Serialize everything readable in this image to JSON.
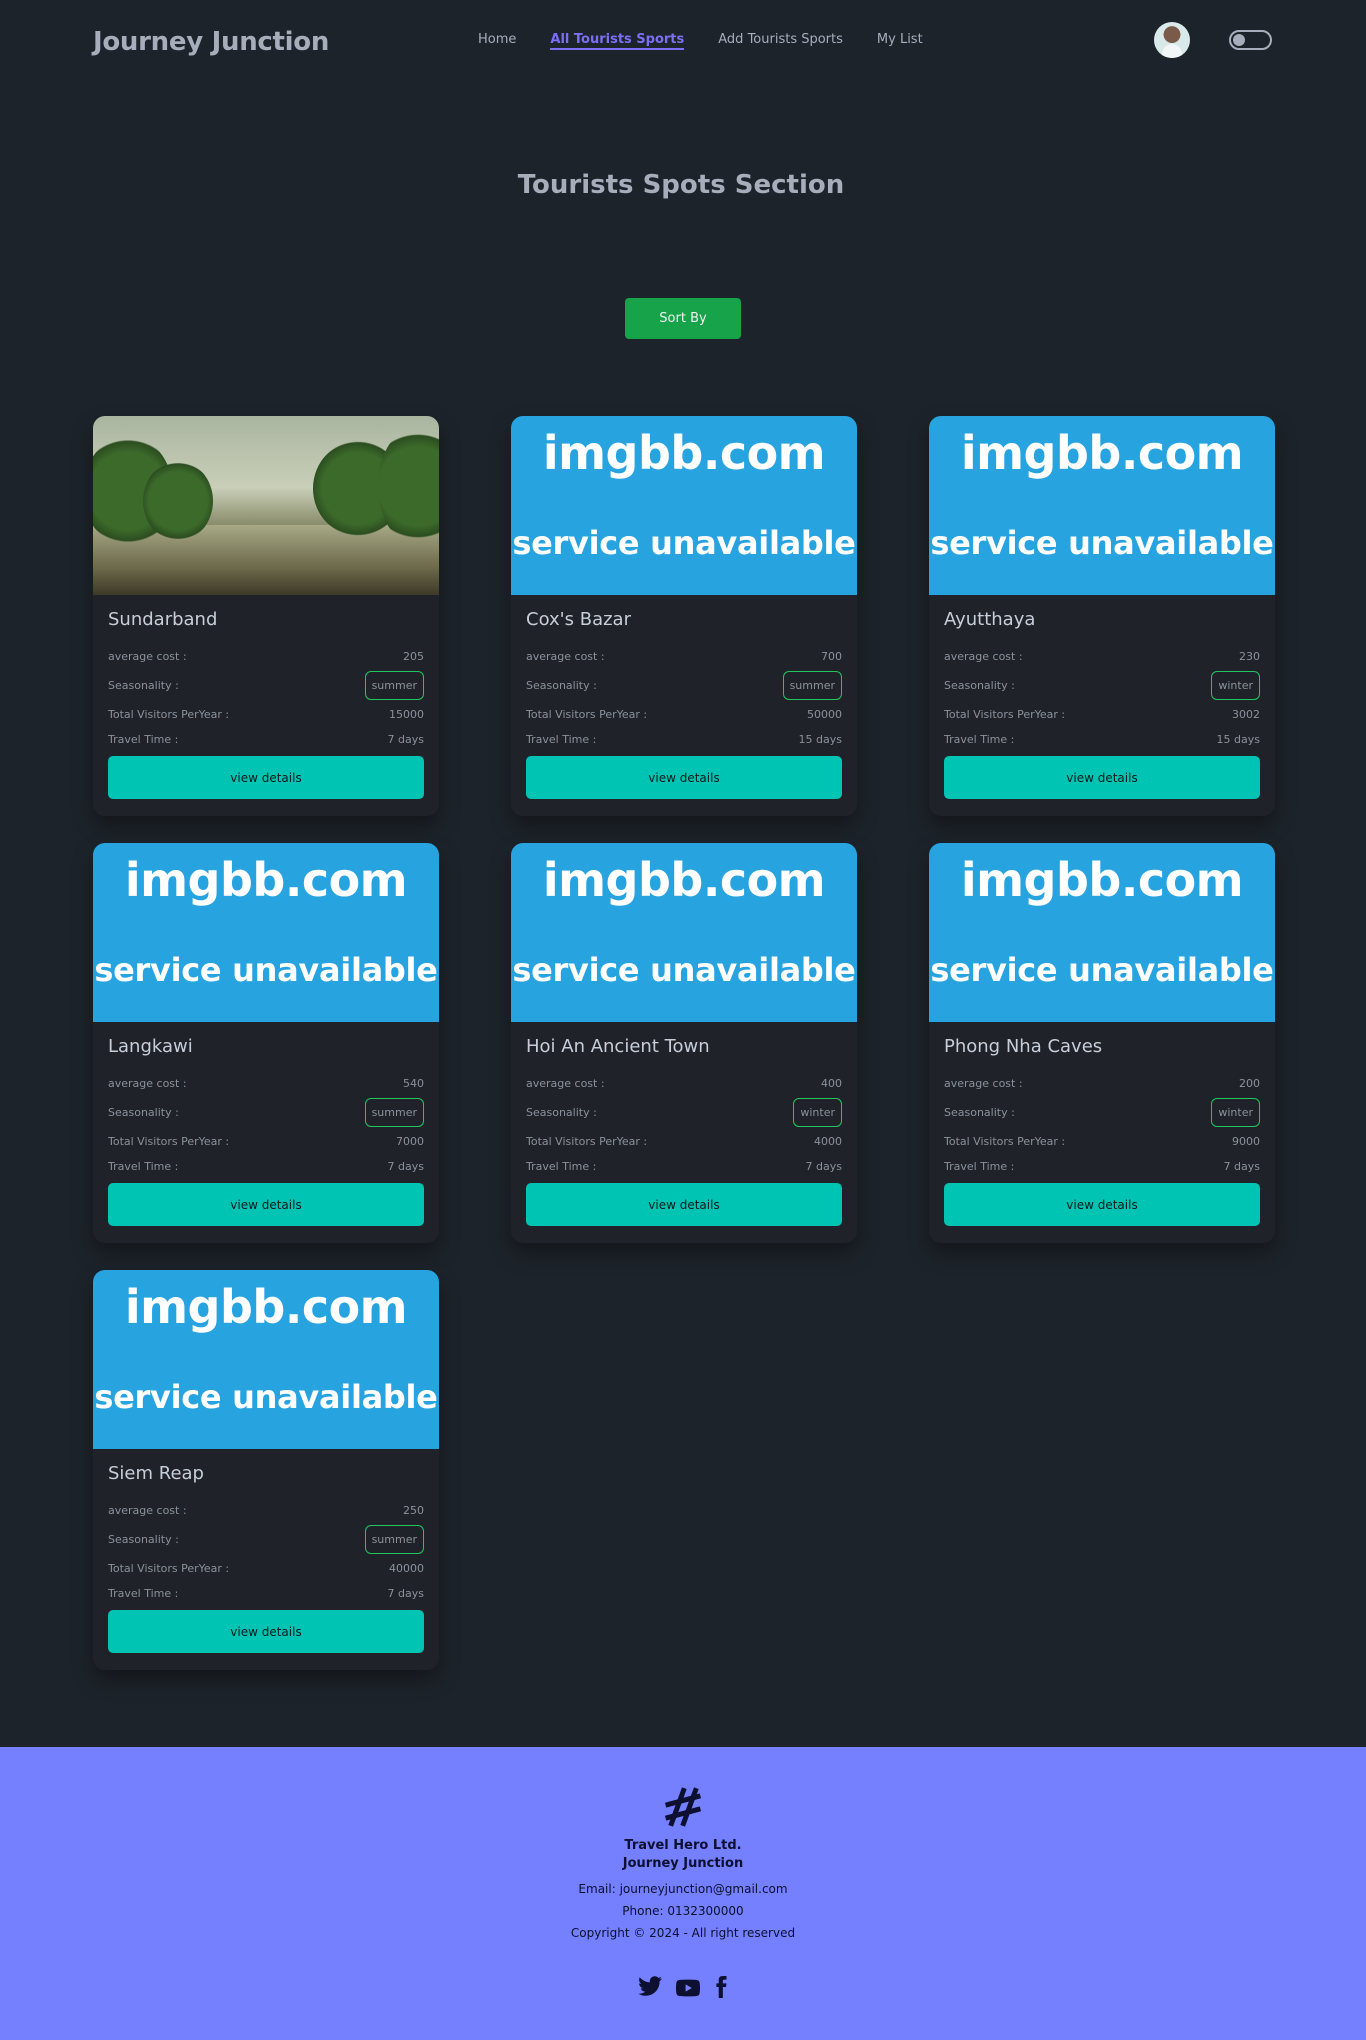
{
  "nav": {
    "brand": "Journey Junction",
    "links": [
      "Home",
      "All Tourists Sports",
      "Add Tourists Sports",
      "My List"
    ],
    "active_index": 1
  },
  "section": {
    "title": "Tourists Spots Section",
    "sort_label": "Sort By"
  },
  "labels": {
    "average_cost": "average cost :",
    "seasonality": "Seasonality :",
    "visitors": "Total Visitors PerYear :",
    "travel_time": "Travel Time :",
    "view_details": "view details",
    "placeholder_line1": "imgbb.com",
    "placeholder_line2": "service unavailable"
  },
  "spots": [
    {
      "name": "Sundarband",
      "cost": "205",
      "season": "summer",
      "visitors": "15000",
      "time": "7 days",
      "image": "photo"
    },
    {
      "name": "Cox's Bazar",
      "cost": "700",
      "season": "summer",
      "visitors": "50000",
      "time": "15 days",
      "image": "placeholder"
    },
    {
      "name": "Ayutthaya",
      "cost": "230",
      "season": "winter",
      "visitors": "3002",
      "time": "15 days",
      "image": "placeholder"
    },
    {
      "name": "Langkawi",
      "cost": "540",
      "season": "summer",
      "visitors": "7000",
      "time": "7 days",
      "image": "placeholder"
    },
    {
      "name": "Hoi An Ancient Town",
      "cost": "400",
      "season": "winter",
      "visitors": "4000",
      "time": "7 days",
      "image": "placeholder"
    },
    {
      "name": "Phong Nha Caves",
      "cost": "200",
      "season": "winter",
      "visitors": "9000",
      "time": "7 days",
      "image": "placeholder"
    },
    {
      "name": "Siem Reap",
      "cost": "250",
      "season": "summer",
      "visitors": "40000",
      "time": "7 days",
      "image": "placeholder"
    }
  ],
  "footer": {
    "company": "Travel Hero Ltd.",
    "brand": "Journey Junction",
    "email": "Email: journeyjunction@gmail.com",
    "phone": "Phone: 0132300000",
    "copyright": "Copyright © 2024 - All right reserved",
    "social_icons": [
      "twitter-icon",
      "youtube-icon",
      "facebook-icon"
    ]
  },
  "colors": {
    "background": "#1d232a",
    "active_link": "#7c6ff6",
    "sort_button": "#16a34a",
    "view_button": "#00c4b3",
    "footer": "#7480ff",
    "placeholder_bg": "#27a3e0"
  }
}
